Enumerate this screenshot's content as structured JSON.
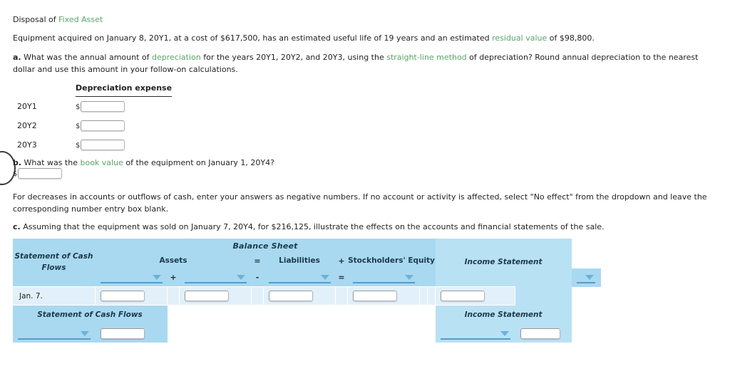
{
  "problem": {
    "title_prefix": "Disposal of ",
    "title_term": "Fixed Asset",
    "intro_part1": "Equipment acquired on January 8, 20Y1, at a cost of $617,500, has an estimated useful life of 19 years and an estimated ",
    "intro_term": "residual value",
    "intro_part2": " of $98,800.",
    "cost": "$617,500",
    "acquired_date": "January 8, 20Y1",
    "useful_life_years": "19",
    "residual_value": "$98,800",
    "sale_date": "January 7, 20Y4",
    "sale_price": "$216,125"
  },
  "part_a": {
    "marker": "a.",
    "text1": "  What was the annual amount of ",
    "term1": "depreciation",
    "text2": " for the years 20Y1, 20Y2, and 20Y3, using the ",
    "term2": "straight-line method",
    "text3": " of depreciation? Round annual depreciation to the nearest dollar and use this amount in your follow-on calculations.",
    "table": {
      "header": "Depreciation expense",
      "currency_symbol": "$",
      "rows": [
        {
          "year": "20Y1",
          "value": ""
        },
        {
          "year": "20Y2",
          "value": ""
        },
        {
          "year": "20Y3",
          "value": ""
        }
      ]
    }
  },
  "part_b": {
    "marker": "b.",
    "text1": "  What was the ",
    "term1": "book value",
    "text2": " of the equipment on January 1, 20Y4?",
    "currency_symbol": "$",
    "answer_value": ""
  },
  "note": "For decreases in accounts or outflows of cash, enter your answers as negative numbers. If no account or activity is affected, select \"No effect\" from the dropdown and leave the corresponding number entry box blank.",
  "part_c": {
    "marker": "c.",
    "text": "  Assuming that the equipment was sold on January 7, 20Y4, for $216,125, illustrate the effects on the accounts and financial statements of the sale."
  },
  "effects_table": {
    "balance_sheet_title": "Balance Sheet",
    "cash_flows_header": "Statement of Cash Flows",
    "assets_header": "Assets",
    "liabilities_header": "Liabilities",
    "equity_header": "Stockholders' Equity",
    "income_statement_header": "Income Statement",
    "operators": {
      "plus": "+",
      "minus": "-",
      "equals": "=",
      "plus2": "+"
    },
    "row_label": "Jan. 7.",
    "dropdown_placeholder": "",
    "input_value": "",
    "footer_cash_flows_label": "Statement of Cash Flows",
    "footer_income_statement_label": "Income Statement"
  }
}
